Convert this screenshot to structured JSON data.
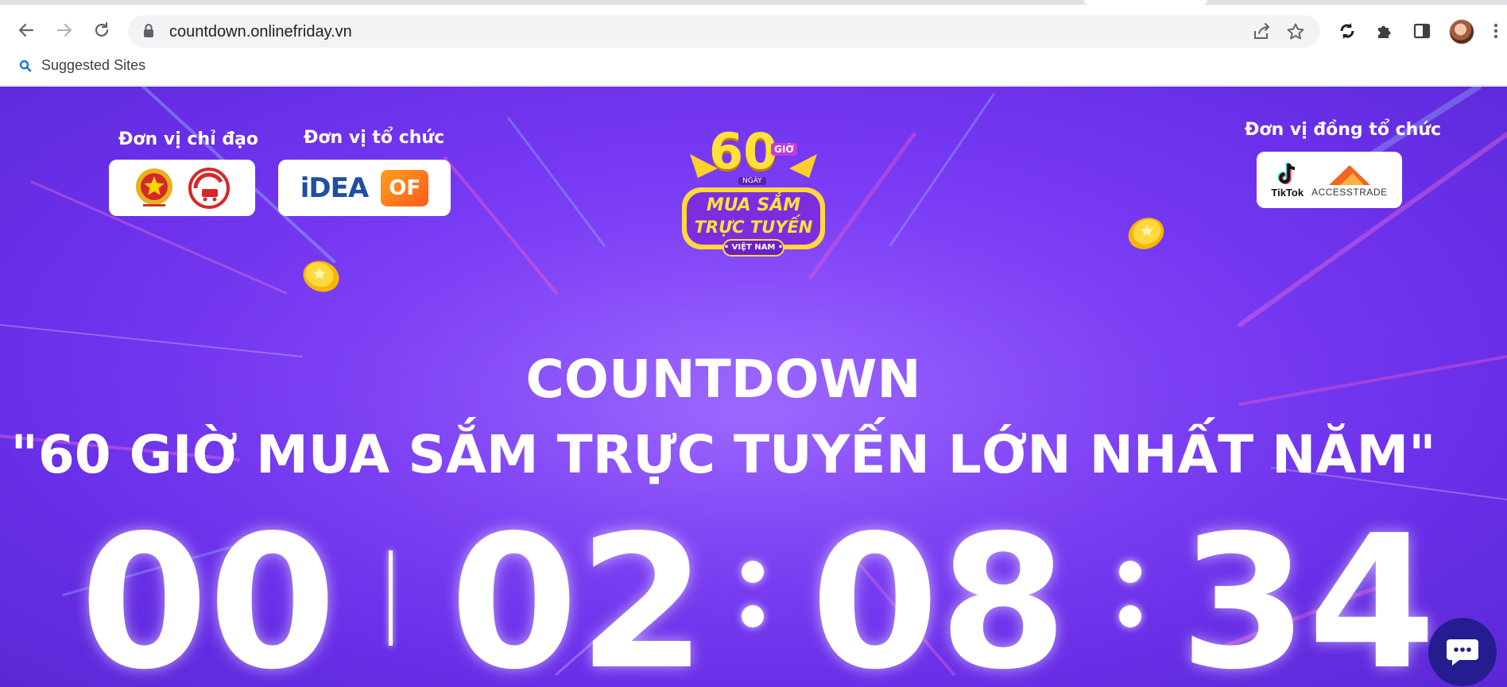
{
  "browser": {
    "url": "countdown.onlinefriday.vn",
    "bookmark_label": "Suggested Sites",
    "icons": [
      "back-arrow-icon",
      "forward-arrow-icon",
      "reload-icon",
      "lock-icon",
      "share-icon",
      "star-icon",
      "sync-icon",
      "extensions-icon",
      "side-panel-icon",
      "avatar",
      "menu-icon",
      "search-icon",
      "chat-icon"
    ]
  },
  "page": {
    "org_direct_label": "Đơn vị chỉ đạo",
    "org_host_label": "Đơn vị tổ chức",
    "org_cohost_label": "Đơn vị đồng tổ chức",
    "logo_idea_text": "iDEA",
    "logo_of_text": "OF",
    "logo_tiktok_text": "TikTok",
    "logo_accesstrade_text": "ACCESSTRADE",
    "center_logo": {
      "number": "60",
      "unit_hour": "GIỜ",
      "unit_day": "NGÀY",
      "line1": "MUA SẮM",
      "line2": "TRỰC TUYẾN",
      "line3": "• VIỆT NAM •"
    },
    "headline1": "COUNTDOWN",
    "headline2": "\"60 GIỜ MUA SẮM TRỰC TUYẾN LỚN NHẤT NĂM\"",
    "countdown": {
      "days": "00",
      "hours": "02",
      "minutes": "08",
      "seconds": "34"
    }
  },
  "colors": {
    "page_background": "#7b3cf6",
    "chat_button": "#241c8f",
    "logo_gold": "#ffd42a"
  }
}
